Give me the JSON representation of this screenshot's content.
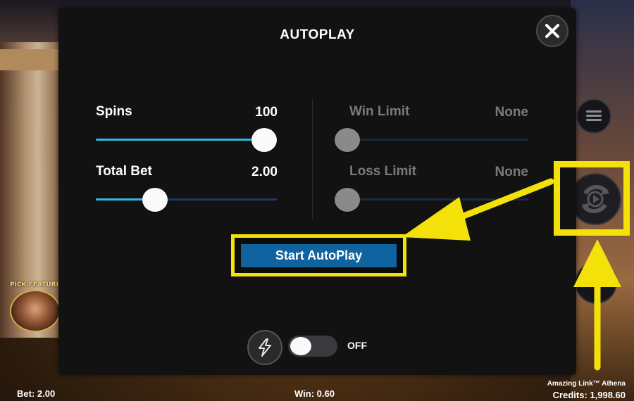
{
  "modal": {
    "title": "AUTOPLAY",
    "spins": {
      "label": "Spins",
      "value": "100",
      "fraction": 1.0
    },
    "total_bet": {
      "label": "Total Bet",
      "value": "2.00",
      "fraction": 0.3
    },
    "win_limit": {
      "label": "Win Limit",
      "value": "None",
      "fraction": 0.0
    },
    "loss_limit": {
      "label": "Loss Limit",
      "value": "None",
      "fraction": 0.0
    },
    "start_button": "Start AutoPlay",
    "turbo_toggle": {
      "state_label": "OFF",
      "on": false
    }
  },
  "side_panel": {
    "pick_feature_label": "PICK FEATURE"
  },
  "footer": {
    "bet": "Bet: 2.00",
    "win": "Win: 0.60",
    "game_name": "Amazing Link™ Athena",
    "credits": "Credits: 1,998.60"
  },
  "colors": {
    "highlight": "#f4e10a",
    "slider_fill": "#2fb8e6",
    "start_button_bg": "#0f64a0"
  }
}
